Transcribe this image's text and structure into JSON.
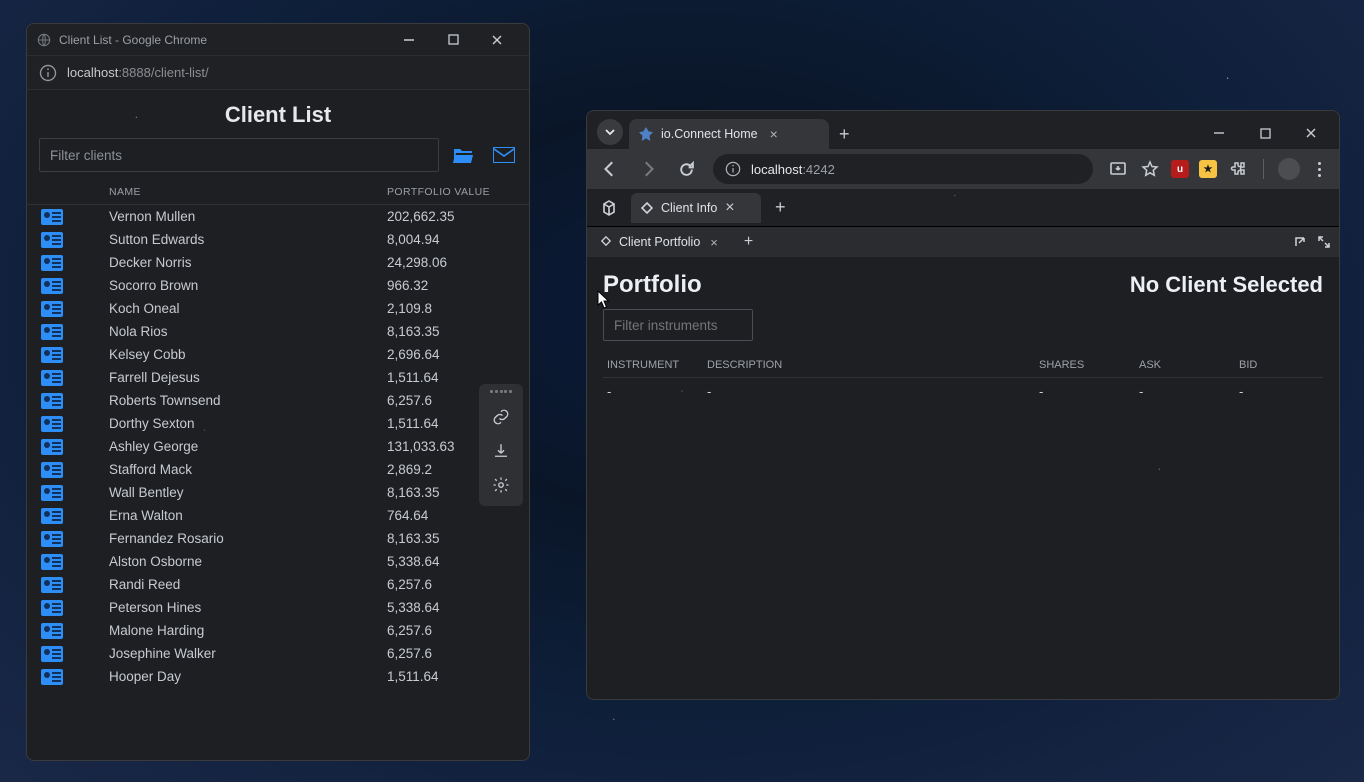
{
  "left": {
    "window_title": "Client List - Google Chrome",
    "url_host": "localhost",
    "url_port": ":8888",
    "url_path": "/client-list/",
    "app_title": "Client List",
    "filter_placeholder": "Filter clients",
    "columns": {
      "name": "NAME",
      "pv": "PORTFOLIO VALUE"
    },
    "clients": [
      {
        "name": "Vernon Mullen",
        "pv": "202,662.35"
      },
      {
        "name": "Sutton Edwards",
        "pv": "8,004.94"
      },
      {
        "name": "Decker Norris",
        "pv": "24,298.06"
      },
      {
        "name": "Socorro Brown",
        "pv": "966.32"
      },
      {
        "name": "Koch Oneal",
        "pv": "2,109.8"
      },
      {
        "name": "Nola Rios",
        "pv": "8,163.35"
      },
      {
        "name": "Kelsey Cobb",
        "pv": "2,696.64"
      },
      {
        "name": "Farrell Dejesus",
        "pv": "1,511.64"
      },
      {
        "name": "Roberts Townsend",
        "pv": "6,257.6"
      },
      {
        "name": "Dorthy Sexton",
        "pv": "1,511.64"
      },
      {
        "name": "Ashley George",
        "pv": "131,033.63"
      },
      {
        "name": "Stafford Mack",
        "pv": "2,869.2"
      },
      {
        "name": "Wall Bentley",
        "pv": "8,163.35"
      },
      {
        "name": "Erna Walton",
        "pv": "764.64"
      },
      {
        "name": "Fernandez Rosario",
        "pv": "8,163.35"
      },
      {
        "name": "Alston Osborne",
        "pv": "5,338.64"
      },
      {
        "name": "Randi Reed",
        "pv": "6,257.6"
      },
      {
        "name": "Peterson Hines",
        "pv": "5,338.64"
      },
      {
        "name": "Malone Harding",
        "pv": "6,257.6"
      },
      {
        "name": "Josephine Walker",
        "pv": "6,257.6"
      },
      {
        "name": "Hooper Day",
        "pv": "1,511.64"
      }
    ]
  },
  "right": {
    "browser_tab_title": "io.Connect Home",
    "url_host": "localhost",
    "url_port": ":4242",
    "inner_tab_title": "Client Info",
    "sub_tab_title": "Client Portfolio",
    "portfolio_title": "Portfolio",
    "no_client": "No Client Selected",
    "filter_placeholder": "Filter instruments",
    "columns": {
      "instrument": "INSTRUMENT",
      "description": "DESCRIPTION",
      "shares": "SHARES",
      "ask": "ASK",
      "bid": "BID"
    },
    "empty_cell": "-"
  }
}
